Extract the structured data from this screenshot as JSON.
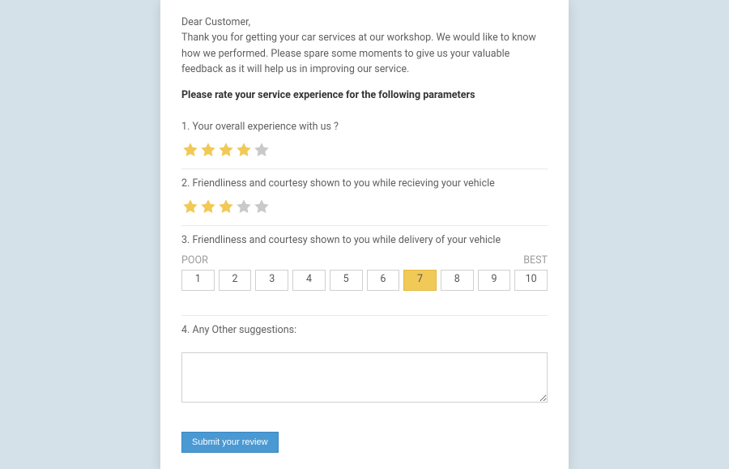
{
  "greeting": {
    "salutation": "Dear Customer,",
    "body": "Thank you for getting your car services at our workshop. We would like to know how we performed. Please spare some moments to give us your valuable feedback as it will help us in improving our service."
  },
  "prompt": "Please rate your service experience for the following parameters",
  "questions": {
    "q1": {
      "number": "1.",
      "text": "Your overall experience with us ?",
      "rating": 4,
      "max": 5
    },
    "q2": {
      "number": "2.",
      "text": "Friendliness and courtesy shown to you while recieving your vehicle",
      "rating": 3,
      "max": 5
    },
    "q3": {
      "number": "3.",
      "text": "Friendliness and courtesy shown to you while delivery of your vehicle",
      "labels": {
        "low": "POOR",
        "high": "BEST"
      },
      "options": [
        "1",
        "2",
        "3",
        "4",
        "5",
        "6",
        "7",
        "8",
        "9",
        "10"
      ],
      "selected": "7"
    },
    "q4": {
      "number": "4.",
      "text": "Any Other suggestions:",
      "value": ""
    }
  },
  "submit_label": "Submit your review",
  "colors": {
    "star_fill": "#f1c957",
    "star_empty": "#c9c9c9",
    "accent": "#4a99d3"
  }
}
